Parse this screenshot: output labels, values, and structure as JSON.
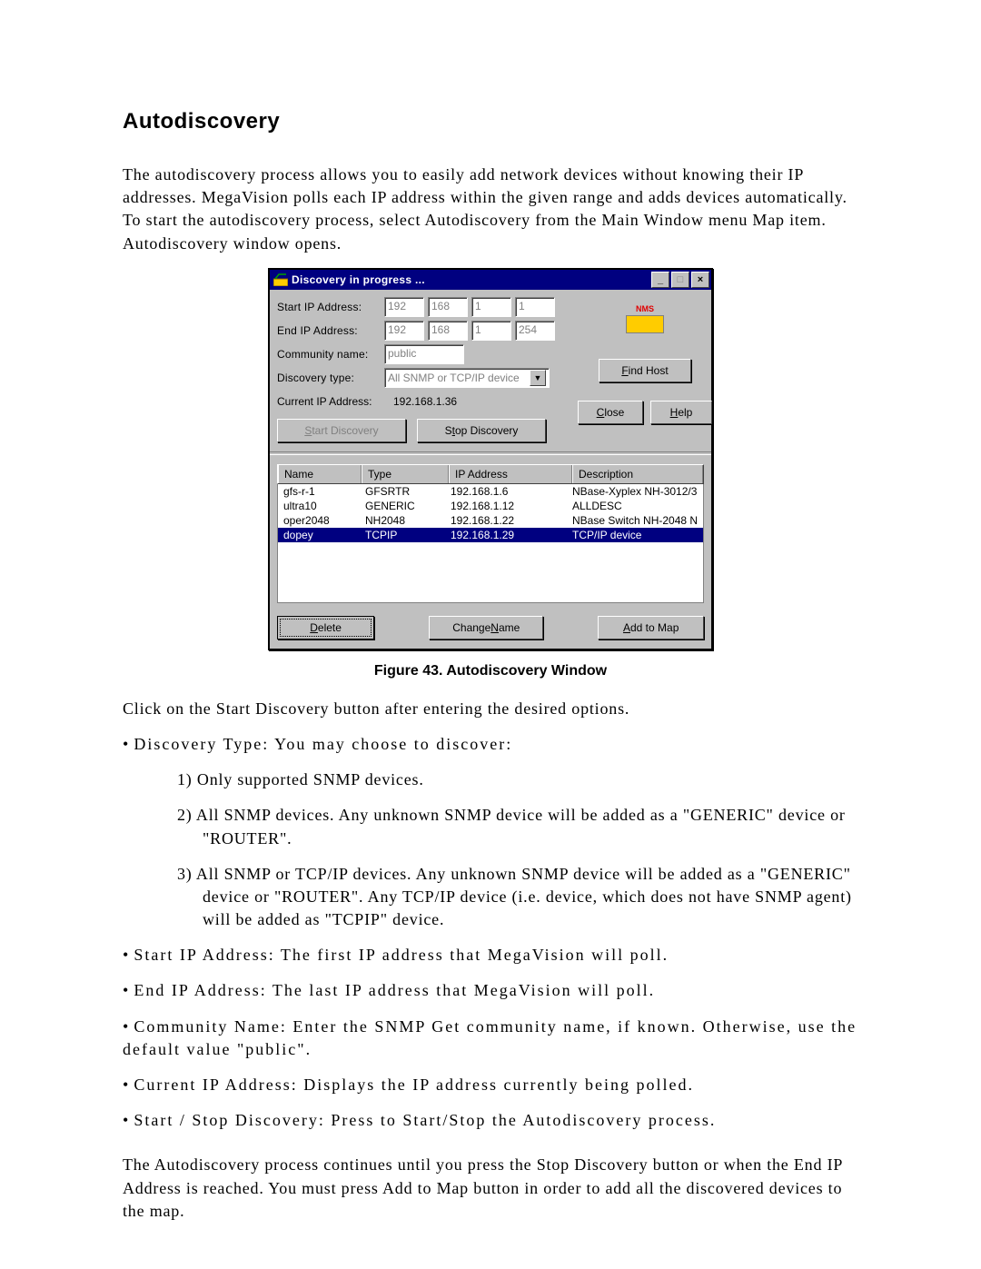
{
  "doc": {
    "heading": "Autodiscovery",
    "intro": "The autodiscovery process allows you to easily add network devices without knowing their IP addresses. MegaVision polls each IP address within the given range and adds devices automatically. To start the autodiscovery process, select Autodiscovery from the Main Window menu Map item. Autodiscovery window opens.",
    "caption": "Figure 43. Autodiscovery Window",
    "para_start": "Click on the Start Discovery button after entering the desired options.",
    "bullets": {
      "disc_type": "Discovery Type: You may choose to discover:",
      "d1": "1)  Only supported SNMP devices.",
      "d2": "2)  All SNMP devices. Any unknown SNMP device will be added as a \"GENERIC\" device or \"ROUTER\".",
      "d3": "3)  All SNMP or TCP/IP devices. Any unknown SNMP device will be added as a \"GENERIC\" device or \"ROUTER\". Any TCP/IP device (i.e. device, which does not have SNMP agent) will be added as \"TCPIP\" device.",
      "startip": "Start IP Address:  The first IP address that MegaVision will poll.",
      "endip": "End IP Address: The last IP address that MegaVision will poll.",
      "comm": "Community Name: Enter the SNMP Get community name, if known. Otherwise, use the default value \"public\".",
      "cur": "Current IP Address: Displays the IP address currently being polled.",
      "ss": "Start / Stop Discovery: Press to Start/Stop the Autodiscovery process."
    },
    "para_end": "The Autodiscovery process continues until you press the Stop Discovery button or when the End IP Address is reached. You must press Add to Map button in order to add all the discovered devices to the map."
  },
  "win": {
    "title": "Discovery in progress ...",
    "logo_text": "NMS",
    "labels": {
      "start_ip": "Start IP Address:",
      "end_ip": "End IP Address:",
      "community": "Community name:",
      "disc_type": "Discovery type:",
      "current_ip": "Current IP Address:"
    },
    "values": {
      "start_ip": [
        "192",
        "168",
        "1",
        "1"
      ],
      "end_ip": [
        "192",
        "168",
        "1",
        "254"
      ],
      "community": "public",
      "disc_type": "All SNMP or TCP/IP device",
      "current_ip": "192.168.1.36"
    },
    "buttons": {
      "find_host": "Find Host",
      "start_discovery": "Start Discovery",
      "stop_discovery": "Stop Discovery",
      "close": "Close",
      "help": "Help",
      "delete": "Delete",
      "change_name": "Change Name",
      "add_to_map": "Add to Map"
    },
    "list": {
      "headers": {
        "name": "Name",
        "type": "Type",
        "ip": "IP Address",
        "desc": "Description"
      },
      "rows": [
        {
          "name": "gfs-r-1",
          "type": "GFSRTR",
          "ip": "192.168.1.6",
          "desc": "NBase-Xyplex NH-3012/3",
          "sel": false
        },
        {
          "name": "ultra10",
          "type": "GENERIC",
          "ip": "192.168.1.12",
          "desc": "ALLDESC",
          "sel": false
        },
        {
          "name": "oper2048",
          "type": "NH2048",
          "ip": "192.168.1.22",
          "desc": "NBase Switch NH-2048 N",
          "sel": false
        },
        {
          "name": "dopey",
          "type": "TCPIP",
          "ip": "192.168.1.29",
          "desc": "TCP/IP device",
          "sel": true
        }
      ]
    }
  }
}
